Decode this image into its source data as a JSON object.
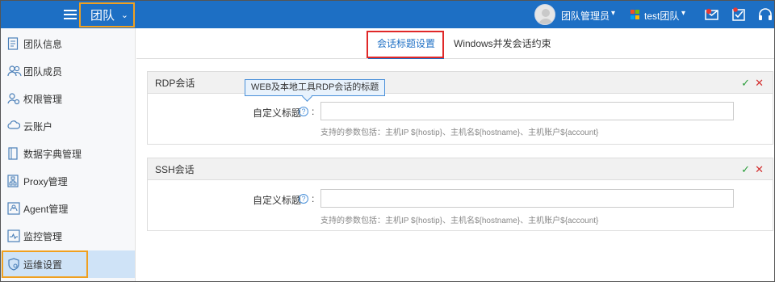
{
  "header": {
    "team_switcher": "团队",
    "user_name": "团队管理员",
    "team_name": "test团队"
  },
  "sidebar": {
    "items": [
      {
        "label": "团队信息",
        "icon": "document-icon"
      },
      {
        "label": "团队成员",
        "icon": "users-icon"
      },
      {
        "label": "权限管理",
        "icon": "user-gear-icon"
      },
      {
        "label": "云账户",
        "icon": "cloud-icon"
      },
      {
        "label": "数据字典管理",
        "icon": "book-icon"
      },
      {
        "label": "Proxy管理",
        "icon": "network-icon"
      },
      {
        "label": "Agent管理",
        "icon": "agent-icon"
      },
      {
        "label": "监控管理",
        "icon": "monitor-icon"
      },
      {
        "label": "运维设置",
        "icon": "shield-gear-icon",
        "active": true
      }
    ]
  },
  "tabs": [
    {
      "label": "会话标题设置",
      "active": true
    },
    {
      "label": "Windows并发会话约束",
      "active": false
    }
  ],
  "panels": [
    {
      "title": "RDP会话",
      "field_label": "自定义标题",
      "help": "?",
      "colon": ":",
      "value": "",
      "hint": "支持的参数包括：主机IP ${hostip}、主机名${hostname}、主机账户${account}"
    },
    {
      "title": "SSH会话",
      "field_label": "自定义标题",
      "help": "?",
      "colon": ":",
      "value": "",
      "hint": "支持的参数包括：主机IP ${hostip}、主机名${hostname}、主机账户${account}"
    }
  ],
  "tooltip": "WEB及本地工具RDP会话的标题",
  "actions": {
    "confirm": "✓",
    "cancel": "✕"
  },
  "colors": {
    "topbar": "#1d6fc4",
    "highlight_orange": "#f0a020",
    "highlight_red": "#e02828",
    "confirm_green": "#2a9d3a",
    "cancel_red": "#d32f2f"
  }
}
